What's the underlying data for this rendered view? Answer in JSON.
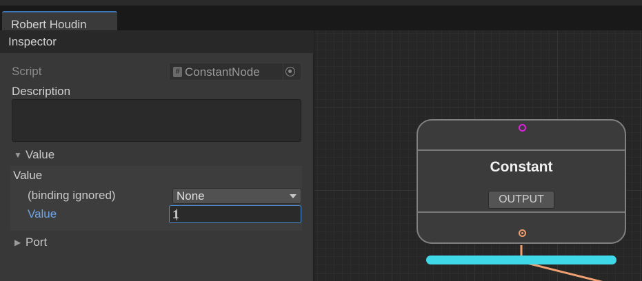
{
  "window": {
    "tab_title": "Robert Houdin"
  },
  "inspector": {
    "header": "Inspector",
    "script": {
      "label": "Script",
      "icon": "csharp-script-icon",
      "value": "ConstantNode"
    },
    "description": {
      "label": "Description",
      "value": ""
    },
    "value_foldout": {
      "label": "Value",
      "expanded": true,
      "inner_label": "Value",
      "binding": {
        "label": "(binding ignored)",
        "selected": "None"
      },
      "value_field": {
        "label": "Value",
        "value": "1"
      }
    },
    "port_foldout": {
      "label": "Port",
      "expanded": false
    }
  },
  "graph": {
    "node": {
      "title": "Constant",
      "output_button": "OUTPUT"
    },
    "colors": {
      "input_port": "#e020e0",
      "output_port": "#f0a070",
      "edge": "#f0a070",
      "drop_indicator": "#3fd8e8",
      "focus": "#4c8ed7"
    }
  }
}
